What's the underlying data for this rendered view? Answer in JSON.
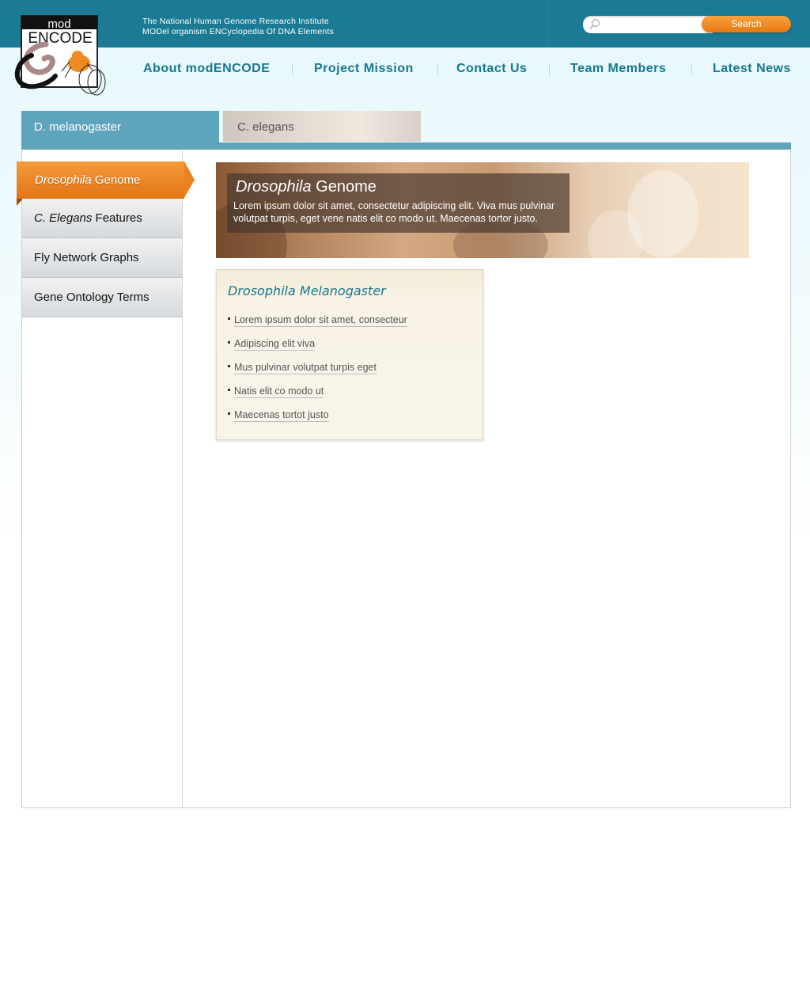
{
  "header": {
    "tagline_line1": "The National Human Genome Research Institute",
    "tagline_line2": "MODel organism ENCyclopedia Of DNA Elements",
    "logo_text_top": "mod",
    "logo_text_bottom": "ENCODE"
  },
  "search": {
    "placeholder": "",
    "button_label": "Search"
  },
  "nav": {
    "items": [
      "About modENCODE",
      "Project Mission",
      "Contact Us",
      "Team Members",
      "Latest News"
    ]
  },
  "tabs": [
    {
      "label": "D. melanogaster",
      "active": true
    },
    {
      "label": "C. elegans",
      "active": false
    }
  ],
  "sidebar": {
    "items": [
      {
        "italic": "Drosophila",
        "rest": " Genome",
        "active": true
      },
      {
        "italic": "C. Elegans",
        "rest": " Features",
        "active": false
      },
      {
        "italic": "",
        "rest": "Fly Network Graphs",
        "active": false
      },
      {
        "italic": "",
        "rest": "Gene Ontology Terms",
        "active": false
      }
    ]
  },
  "hero": {
    "title_italic": "Drosophila",
    "title_rest": " Genome",
    "text": "Lorem ipsum dolor sit amet, consectetur adipiscing elit. Viva mus pulvinar volutpat turpis, eget vene natis elit co modo ut. Maecenas tortor justo."
  },
  "card": {
    "title": "Drosophila Melanogaster",
    "links": [
      "Lorem ipsum dolor sit amet, consecteur",
      "Adipiscing elit viva",
      "Mus pulvinar volutpat turpis eget",
      "Natis elit co modo ut",
      "Maecenas tortot justo"
    ]
  },
  "colors": {
    "header_teal": "#1b7a94",
    "nav_text": "#16788f",
    "tab_active": "#5fa4bd",
    "accent_orange": "#ee8a25"
  }
}
